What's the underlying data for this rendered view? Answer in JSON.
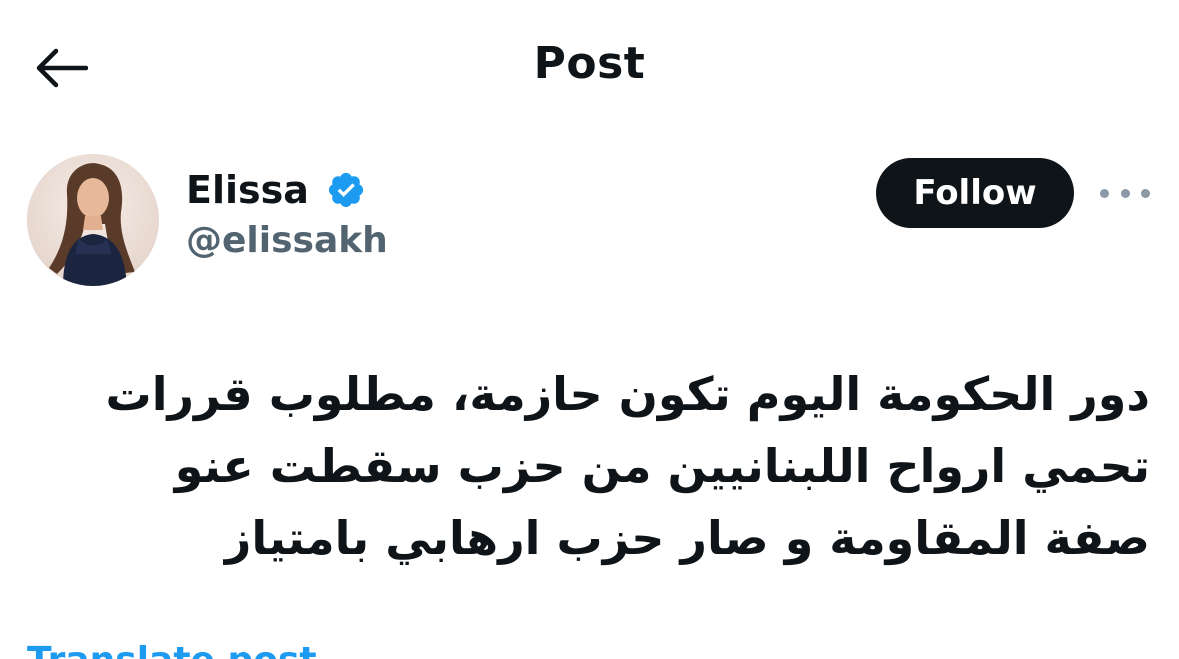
{
  "header": {
    "back_icon": "arrow-left-icon",
    "title": "Post"
  },
  "author": {
    "display_name": "Elissa",
    "handle": "@elissakh",
    "verified_icon": "verified-badge-icon",
    "verified_color": "#1d9bf0"
  },
  "actions": {
    "follow_label": "Follow",
    "more_icon": "more-options-icon"
  },
  "post": {
    "text": "دور الحكومة اليوم تكون حازمة، مطلوب قررات تحمي ارواح اللبنانيين من حزب سقطت عنو صفة المقاومة و صار حزب ارهابي بامتياز",
    "translate_label": "Translate post"
  },
  "colors": {
    "text_primary": "#0f1419",
    "text_secondary": "#536471",
    "accent": "#1d9bf0",
    "follow_bg": "#0f1419"
  }
}
